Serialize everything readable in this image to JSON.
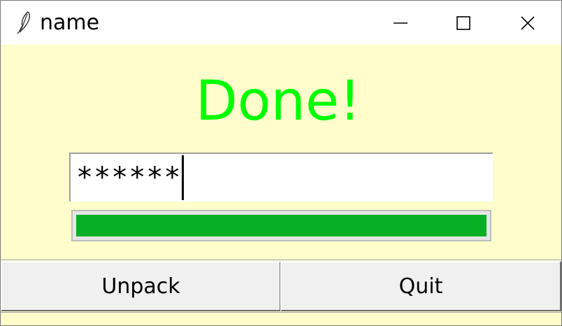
{
  "window": {
    "title": "name",
    "controls": {
      "minimize_icon": "minimize-icon",
      "maximize_icon": "maximize-icon",
      "close_icon": "close-icon"
    },
    "app_icon": "feather-icon"
  },
  "status": {
    "text": "Done!",
    "color": "#00ff00"
  },
  "password_field": {
    "value": "******"
  },
  "progress": {
    "value": 1.0,
    "fill_color": "#06b025"
  },
  "buttons": {
    "unpack_label": "Unpack",
    "quit_label": "Quit"
  },
  "colors": {
    "background": "#fffdcc"
  }
}
